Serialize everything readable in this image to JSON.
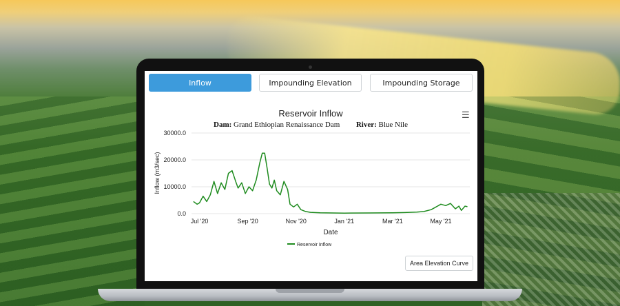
{
  "tabs": [
    {
      "label": "Inflow",
      "active": true
    },
    {
      "label": "Impounding Elevation",
      "active": false
    },
    {
      "label": "Impounding Storage",
      "active": false
    }
  ],
  "chart_title": "Reservoir Inflow",
  "dam_label": "Dam:",
  "dam_value": "Grand Ethiopian Renaissance Dam",
  "river_label": "River:",
  "river_value": "Blue Nile",
  "menu_icon": "hamburger-menu-icon",
  "footer_button": "Area Elevation Curve",
  "colors": {
    "accent": "#3d9bdc",
    "series": "#1e8b1e"
  },
  "chart_data": {
    "type": "line",
    "xlabel": "Date",
    "ylabel": "Inflow (m3/sec)",
    "ylim": [
      0,
      30000
    ],
    "y_ticks": [
      "0.0",
      "10000.0",
      "20000.0",
      "30000.0"
    ],
    "x_ticks": [
      "Jul '20",
      "Sep '20",
      "Nov '20",
      "Jan '21",
      "Mar '21",
      "May '21"
    ],
    "x_tick_months": [
      0,
      2,
      4,
      6,
      8,
      10
    ],
    "grid": true,
    "legend_position": "bottom",
    "series": [
      {
        "name": "Reservoir Inflow",
        "points": [
          [
            -0.25,
            4500
          ],
          [
            -0.1,
            3500
          ],
          [
            0.0,
            4000
          ],
          [
            0.15,
            6500
          ],
          [
            0.3,
            4500
          ],
          [
            0.45,
            7000
          ],
          [
            0.6,
            12000
          ],
          [
            0.75,
            7500
          ],
          [
            0.9,
            11500
          ],
          [
            1.05,
            9000
          ],
          [
            1.2,
            15000
          ],
          [
            1.35,
            16000
          ],
          [
            1.5,
            12000
          ],
          [
            1.6,
            9500
          ],
          [
            1.75,
            11500
          ],
          [
            1.9,
            7500
          ],
          [
            2.05,
            10000
          ],
          [
            2.2,
            8500
          ],
          [
            2.35,
            12500
          ],
          [
            2.5,
            19000
          ],
          [
            2.6,
            22500
          ],
          [
            2.7,
            22500
          ],
          [
            2.8,
            17000
          ],
          [
            2.9,
            11000
          ],
          [
            3.0,
            9500
          ],
          [
            3.1,
            12500
          ],
          [
            3.2,
            8500
          ],
          [
            3.35,
            7000
          ],
          [
            3.5,
            12000
          ],
          [
            3.65,
            9000
          ],
          [
            3.75,
            3500
          ],
          [
            3.9,
            2500
          ],
          [
            4.05,
            3500
          ],
          [
            4.2,
            1500
          ],
          [
            4.4,
            800
          ],
          [
            4.6,
            500
          ],
          [
            5.0,
            300
          ],
          [
            6.0,
            200
          ],
          [
            7.0,
            250
          ],
          [
            8.0,
            300
          ],
          [
            8.5,
            400
          ],
          [
            9.0,
            600
          ],
          [
            9.3,
            800
          ],
          [
            9.6,
            1500
          ],
          [
            9.8,
            2500
          ],
          [
            10.0,
            3500
          ],
          [
            10.2,
            3000
          ],
          [
            10.4,
            3800
          ],
          [
            10.6,
            1800
          ],
          [
            10.75,
            2800
          ],
          [
            10.85,
            1200
          ],
          [
            11.0,
            2800
          ],
          [
            11.1,
            2600
          ]
        ]
      }
    ]
  }
}
